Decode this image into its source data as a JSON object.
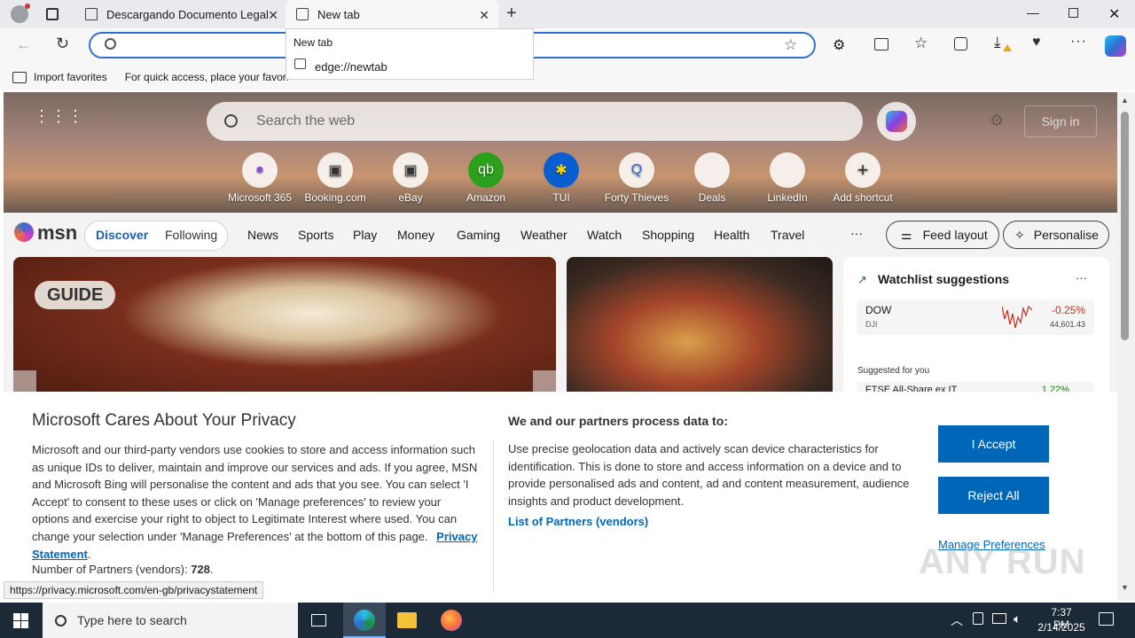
{
  "tabs": [
    {
      "title": "Descargando Documento Legal"
    },
    {
      "title": "New tab"
    }
  ],
  "dropdown": {
    "heading": "New tab",
    "item": "edge://newtab"
  },
  "bookmarks": {
    "import": "Import favorites",
    "hint": "For quick access, place your favori"
  },
  "msn": {
    "search_placeholder": "Search the web",
    "sign_in": "Sign in",
    "shortcuts": [
      "Microsoft 365",
      "Booking.com",
      "eBay",
      "Amazon",
      "TUI",
      "Forty Thieves",
      "Deals",
      "LinkedIn",
      "Add shortcut"
    ],
    "logo": "msn",
    "nav": [
      "Discover",
      "Following",
      "News",
      "Sports",
      "Play",
      "Money",
      "Gaming",
      "Weather",
      "Watch",
      "Shopping",
      "Health",
      "Travel"
    ],
    "more": "···",
    "feed_layout": "Feed layout",
    "personalise": "Personalise",
    "guide_badge": "GUIDE"
  },
  "watchlist": {
    "title": "Watchlist suggestions",
    "more": "···",
    "stock_name": "DOW",
    "stock_code": "DJI",
    "stock_change": "-0.25%",
    "stock_value": "44,601.43",
    "suggested": "Suggested for you",
    "next_name": "FTSE All-Share ex IT",
    "next_change": "1.22%"
  },
  "privacy": {
    "title": "Microsoft Cares About Your Privacy",
    "body": "Microsoft and our third-party vendors use cookies to store and access information such as unique IDs to deliver, maintain and improve our services and ads. If you agree, MSN and Microsoft Bing will personalise the content and ads that you see. You can select 'I Accept' to consent to these uses or click on 'Manage preferences' to review your options and exercise your right to object to Legitimate Interest where used.  You can change your selection under 'Manage Preferences' at the bottom of this page.",
    "privacy_link": "Privacy Statement",
    "partners_label": "Number of Partners (vendors):",
    "partners_count": "728",
    "right_heading": "We and our partners process data to:",
    "right_body": "Use precise geolocation data and actively scan device characteristics for identification. This is done to store and access information on a device and to provide personalised ads and content, ad and content measurement, audience insights and product development.",
    "partners_link": "List of Partners (vendors)",
    "accept": "I Accept",
    "reject": "Reject All",
    "manage": "Manage Preferences"
  },
  "status_url": "https://privacy.microsoft.com/en-gb/privacystatement",
  "taskbar": {
    "search_placeholder": "Type here to search",
    "time": "7:37 PM",
    "date": "2/14/2025"
  },
  "watermark": "ANY RUN"
}
